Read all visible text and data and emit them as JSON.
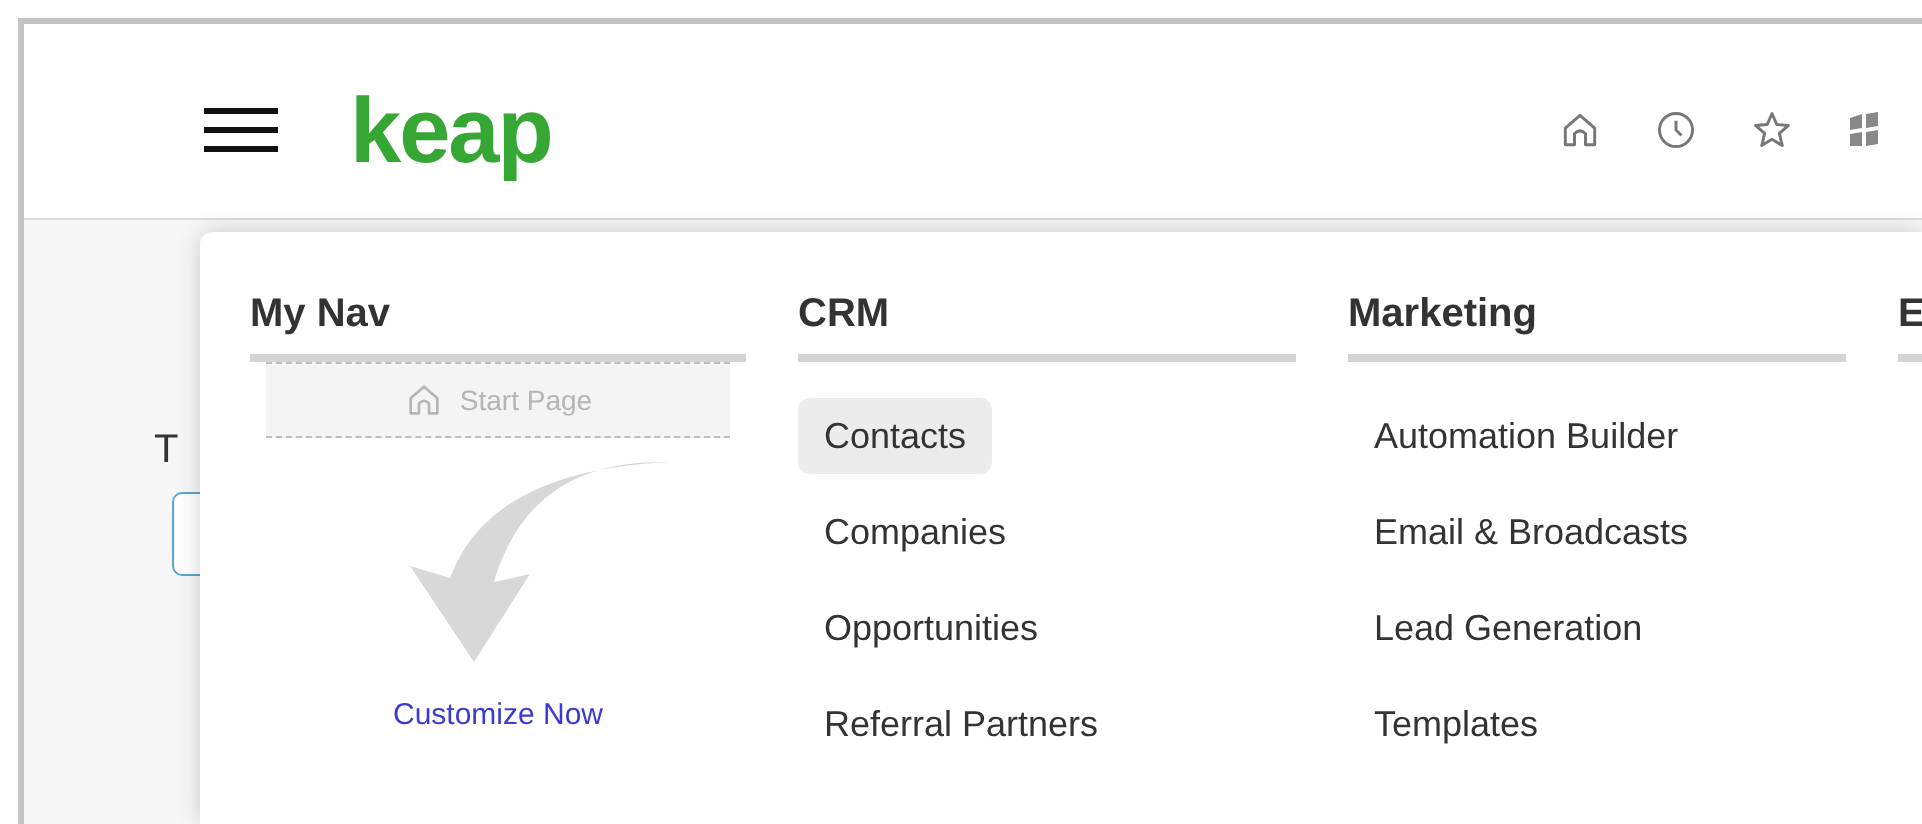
{
  "header": {
    "logo": "keap"
  },
  "page": {
    "text": "T"
  },
  "menu": {
    "my_nav": {
      "heading": "My Nav",
      "start_page": "Start Page",
      "customize_link": "Customize Now"
    },
    "columns": [
      {
        "heading": "CRM",
        "items": [
          {
            "label": "Contacts",
            "selected": true
          },
          {
            "label": "Companies",
            "selected": false
          },
          {
            "label": "Opportunities",
            "selected": false
          },
          {
            "label": "Referral Partners",
            "selected": false
          }
        ]
      },
      {
        "heading": "Marketing",
        "items": [
          {
            "label": "Automation Builder",
            "selected": false
          },
          {
            "label": "Email & Broadcasts",
            "selected": false
          },
          {
            "label": "Lead Generation",
            "selected": false
          },
          {
            "label": "Templates",
            "selected": false
          }
        ]
      },
      {
        "heading": "E"
      }
    ]
  }
}
